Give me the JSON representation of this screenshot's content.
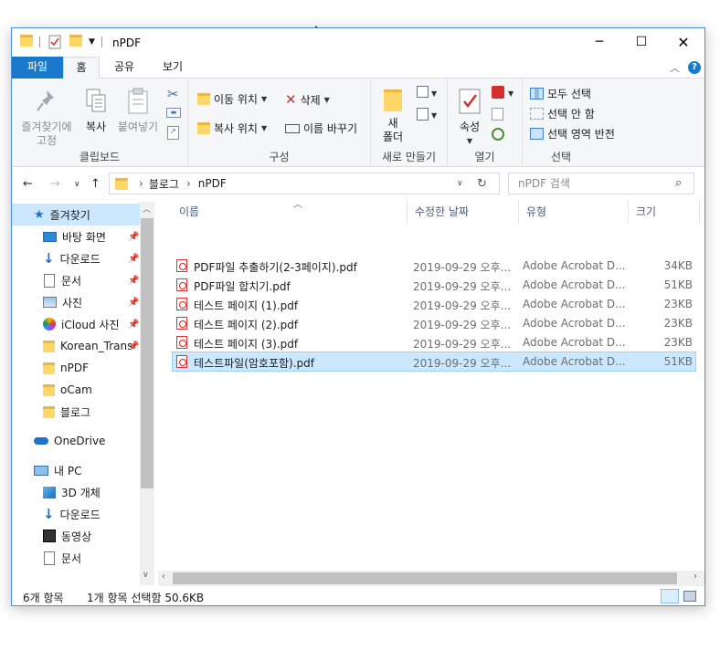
{
  "title": "nPDF",
  "tabs": [
    {
      "label": "파일"
    },
    {
      "label": "홈"
    },
    {
      "label": "공유"
    },
    {
      "label": "보기"
    }
  ],
  "ribbon": {
    "clipboard": {
      "label": "클립보드",
      "pin_label_1": "즐겨찾기에",
      "pin_label_2": "고정",
      "copy": "복사",
      "paste": "붙여넣기"
    },
    "organize": {
      "label": "구성",
      "move_to": "이동 위치",
      "copy_to": "복사 위치",
      "delete": "삭제",
      "rename": "이름 바꾸기"
    },
    "new": {
      "label": "새로 만들기",
      "new_folder_1": "새",
      "new_folder_2": "폴더"
    },
    "open": {
      "label": "열기",
      "properties": "속성"
    },
    "select": {
      "label": "선택",
      "select_all": "모두 선택",
      "select_none": "선택 안 함",
      "invert": "선택 영역 반전"
    }
  },
  "address": {
    "crumbs": [
      "블로그",
      "nPDF"
    ],
    "search_placeholder": "nPDF 검색"
  },
  "nav": {
    "items": [
      {
        "label": "즐겨찾기",
        "icon": "star-icon"
      },
      {
        "label": "바탕 화면",
        "icon": "desktop-icon"
      },
      {
        "label": "다운로드",
        "icon": "download-icon"
      },
      {
        "label": "문서",
        "icon": "document-icon"
      },
      {
        "label": "사진",
        "icon": "pictures-icon"
      },
      {
        "label": "iCloud 사진",
        "icon": "icloud-icon"
      },
      {
        "label": "Korean_Trans",
        "icon": "folder-icon"
      },
      {
        "label": "nPDF",
        "icon": "folder-icon"
      },
      {
        "label": "oCam",
        "icon": "folder-icon"
      },
      {
        "label": "블로그",
        "icon": "folder-icon"
      },
      {
        "label": "OneDrive",
        "icon": "onedrive-icon"
      },
      {
        "label": "내 PC",
        "icon": "pc-icon"
      },
      {
        "label": "3D 개체",
        "icon": "3d-objects-icon"
      },
      {
        "label": "다운로드",
        "icon": "download-icon"
      },
      {
        "label": "동영상",
        "icon": "video-icon"
      },
      {
        "label": "문서",
        "icon": "document-icon"
      }
    ]
  },
  "columns": {
    "name": "이름",
    "date": "수정한 날짜",
    "type": "유형",
    "size": "크기"
  },
  "files": [
    {
      "name": "PDF파일 추출하기(2-3페이지).pdf",
      "date": "2019-09-29 오후...",
      "type": "Adobe Acrobat D...",
      "size": "34KB"
    },
    {
      "name": "PDF파일 합치기.pdf",
      "date": "2019-09-29 오후...",
      "type": "Adobe Acrobat D...",
      "size": "51KB"
    },
    {
      "name": "테스트 페이지 (1).pdf",
      "date": "2019-09-29 오후...",
      "type": "Adobe Acrobat D...",
      "size": "23KB"
    },
    {
      "name": "테스트 페이지 (2).pdf",
      "date": "2019-09-29 오후...",
      "type": "Adobe Acrobat D...",
      "size": "23KB"
    },
    {
      "name": "테스트 페이지 (3).pdf",
      "date": "2019-09-29 오후...",
      "type": "Adobe Acrobat D...",
      "size": "23KB"
    },
    {
      "name": "테스트파일(암호포함).pdf",
      "date": "2019-09-29 오후...",
      "type": "Adobe Acrobat D...",
      "size": "51KB"
    }
  ],
  "status": {
    "count": "6개 항목",
    "selected": "1개 항목 선택함 50.6KB"
  },
  "colors": {
    "accent": "#1979ca",
    "selection": "#cce8ff",
    "pdf_red": "#d32f2f"
  }
}
